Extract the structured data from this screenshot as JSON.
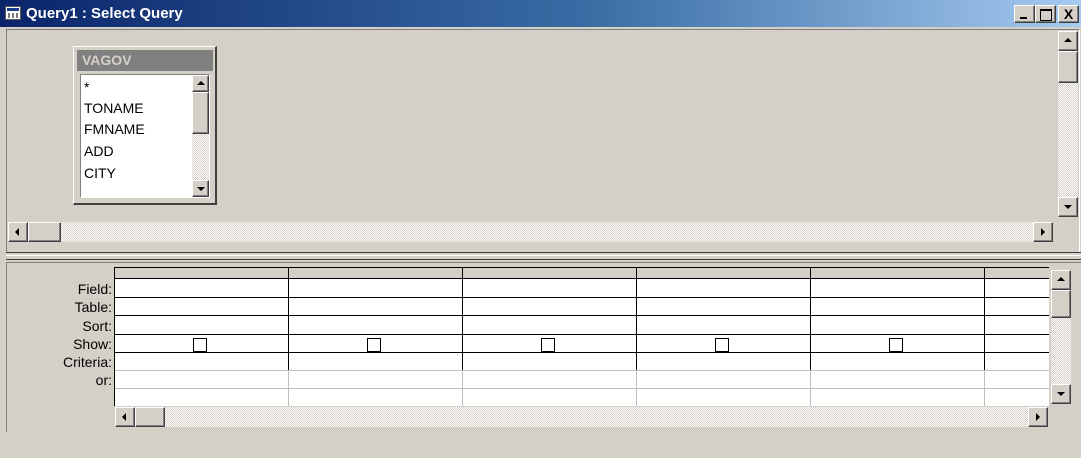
{
  "window": {
    "title": "Query1 : Select Query",
    "icon": "query-icon",
    "controls": {
      "minimize": "minimize-icon",
      "maximize": "maximize-icon",
      "close_label": "X"
    }
  },
  "table": {
    "name": "VAGOV",
    "fields": [
      "*",
      "TONAME",
      "FMNAME",
      "ADD",
      "CITY"
    ]
  },
  "grid": {
    "row_labels": [
      "Field:",
      "Table:",
      "Sort:",
      "Show:",
      "Criteria:",
      "or:"
    ],
    "columns": [
      {
        "field": "",
        "table": "",
        "sort": "",
        "show": false,
        "criteria": "",
        "or": ""
      },
      {
        "field": "",
        "table": "",
        "sort": "",
        "show": false,
        "criteria": "",
        "or": ""
      },
      {
        "field": "",
        "table": "",
        "sort": "",
        "show": false,
        "criteria": "",
        "or": ""
      },
      {
        "field": "",
        "table": "",
        "sort": "",
        "show": false,
        "criteria": "",
        "or": ""
      },
      {
        "field": "",
        "table": "",
        "sort": "",
        "show": false,
        "criteria": "",
        "or": ""
      },
      {
        "field": "",
        "table": "",
        "sort": "",
        "show": false,
        "criteria": "",
        "or": ""
      }
    ]
  },
  "colors": {
    "title_bar_start": "#0a246a",
    "title_bar_end": "#a6caf0",
    "window_face": "#d4d0c8",
    "table_title_bar": "#808080"
  }
}
